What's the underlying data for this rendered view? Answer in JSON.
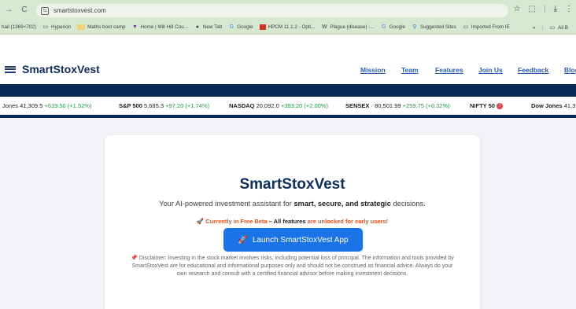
{
  "browser": {
    "url": "smartstoxvest.com",
    "bookmarks": [
      {
        "icon": "",
        "label": "hail (1369×702)"
      },
      {
        "icon": "folder-icon",
        "label": "Hyperion"
      },
      {
        "icon": "tile-icon",
        "label": "Maths boot camp"
      },
      {
        "icon": "bookmark-icon",
        "label": "Home | Mill Hill Cou..."
      },
      {
        "icon": "globe-icon",
        "label": "New Tab"
      },
      {
        "icon": "google-icon",
        "label": "Google"
      },
      {
        "icon": "red-square-icon",
        "label": "HPCM 11.1.2 - Opti..."
      },
      {
        "icon": "wiki-icon",
        "label": "Plague (disease) -..."
      },
      {
        "icon": "google-icon",
        "label": "Google"
      },
      {
        "icon": "search-icon",
        "label": "Suggested Sites"
      },
      {
        "icon": "folder-icon",
        "label": "Imported From IE"
      }
    ],
    "bookmarks_right": {
      "more": "»",
      "all": "All B"
    }
  },
  "header": {
    "logo_text": "SmartStoxVest",
    "nav": [
      "Mission",
      "Team",
      "Features",
      "Join Us",
      "Feedback",
      "Blog"
    ]
  },
  "ticker": [
    {
      "name": "Jones",
      "value": "41,309.5",
      "change": "+619.50 (+1.52%)"
    },
    {
      "name": "S&P 500",
      "value": "5,685.3",
      "change": "+97.20 (+1.74%)"
    },
    {
      "name": "NASDAQ",
      "value": "20,092.0",
      "change": "+393.20 (+2.00%)"
    },
    {
      "name": "SENSEX",
      "value": "80,501.99",
      "change": "+259.75 (+0.32%)"
    },
    {
      "name": "NIFTY 50",
      "value": "",
      "change": ""
    },
    {
      "name": "Dow Jones",
      "value": "41,3",
      "change": ""
    }
  ],
  "hero": {
    "title": "SmartStoxVest",
    "tagline_prefix": "Your AI-powered investment assistant for ",
    "tagline_bold": "smart, secure, and strategic",
    "tagline_suffix": " decisions.",
    "beta_icon": "🚀",
    "beta_orange": "Currently in Free Beta",
    "beta_sep": " – ",
    "beta_dark": "All features",
    "beta_orange_2": " are unlocked for early users!",
    "button_icon": "🚀",
    "button_label": "Launch SmartStoxVest App",
    "disclaimer_icon": "📌",
    "disclaimer": "Disclaimer: Investing in the stock market involves risks, including potential loss of principal. The information and tools provided by SmartStoxVest are for educational and informational purposes only and should not be construed as financial advice. Always do your own research and consult with a certified financial advisor before making investment decisions."
  },
  "colors": {
    "brand_navy": "#0d2d5e",
    "band_navy": "#082a56",
    "link_blue": "#2a5db0",
    "button_blue": "#1b73e8",
    "up_green": "#1e9e3e",
    "beta_orange": "#e8501c"
  }
}
